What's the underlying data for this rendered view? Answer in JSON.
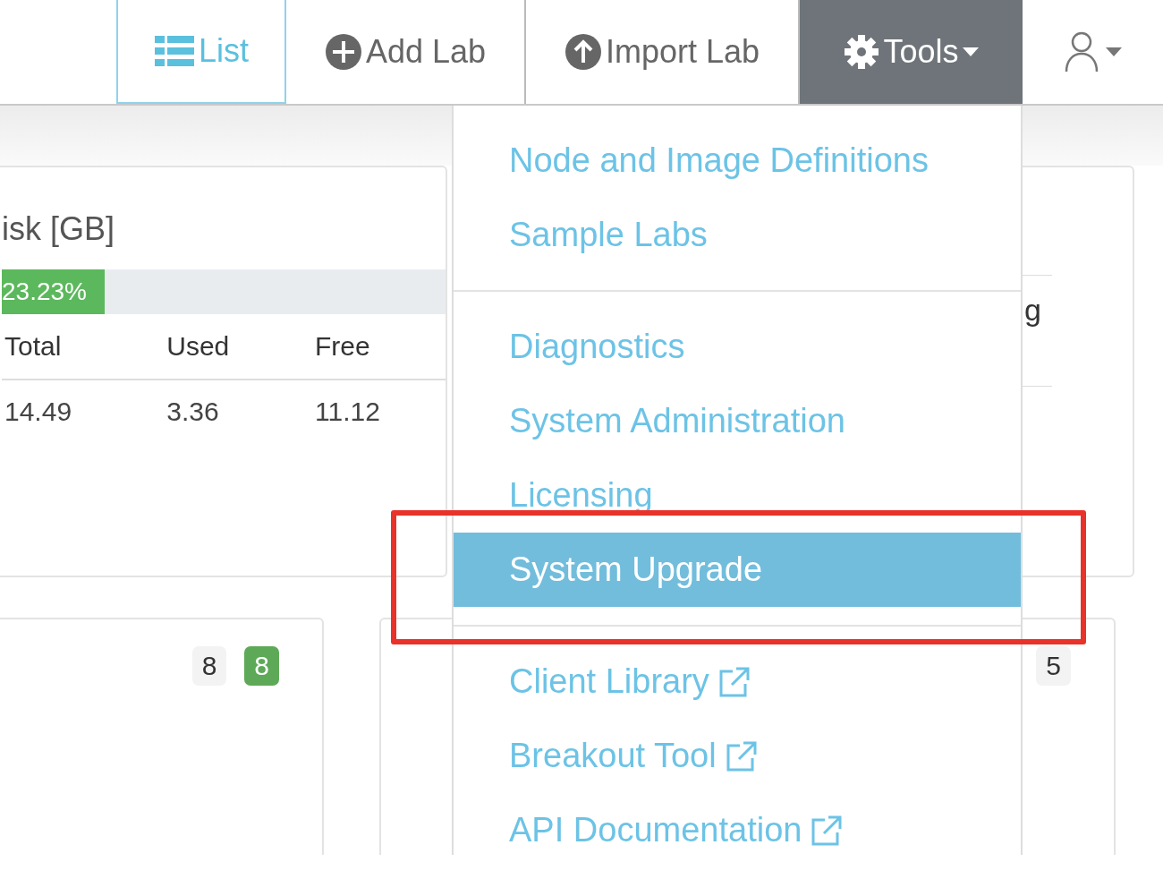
{
  "nav": {
    "tabs": [
      {
        "kind": "list",
        "label": "List",
        "selected": true
      },
      {
        "kind": "add",
        "label": "Add Lab",
        "selected": false
      },
      {
        "kind": "import",
        "label": "Import Lab",
        "selected": false
      }
    ],
    "tools": {
      "label": "Tools",
      "open": true
    }
  },
  "tools_menu": {
    "sections": [
      [
        {
          "label": "Node and Image Definitions",
          "selected": false,
          "external": false,
          "highlighted": false
        },
        {
          "label": "Sample Labs",
          "selected": false,
          "external": false,
          "highlighted": false
        }
      ],
      [
        {
          "label": "Diagnostics",
          "selected": false,
          "external": false,
          "highlighted": false
        },
        {
          "label": "System Administration",
          "selected": false,
          "external": false,
          "highlighted": false
        },
        {
          "label": "Licensing",
          "selected": false,
          "external": false,
          "highlighted": false
        },
        {
          "label": "System Upgrade",
          "selected": true,
          "external": false,
          "highlighted": true
        }
      ],
      [
        {
          "label": "Client Library",
          "selected": false,
          "external": true,
          "highlighted": false
        },
        {
          "label": "Breakout Tool",
          "selected": false,
          "external": true,
          "highlighted": false
        },
        {
          "label": "API Documentation",
          "selected": false,
          "external": true,
          "highlighted": false
        }
      ]
    ]
  },
  "disk_card": {
    "title": "isk [GB]",
    "progress": {
      "level": 0.2323,
      "label": "23.23%"
    },
    "columns": [
      "Total",
      "Used",
      "Free"
    ],
    "rows": [
      [
        "14.49",
        "3.36",
        "11.12"
      ]
    ]
  },
  "side_card": {
    "text": "g"
  },
  "lower_left_card": {
    "badges": [
      {
        "text": "8",
        "kind": "default"
      },
      {
        "text": "8",
        "kind": "success"
      }
    ]
  },
  "lower_right_card": {
    "badges": [
      {
        "text": "5",
        "kind": "default"
      }
    ]
  }
}
